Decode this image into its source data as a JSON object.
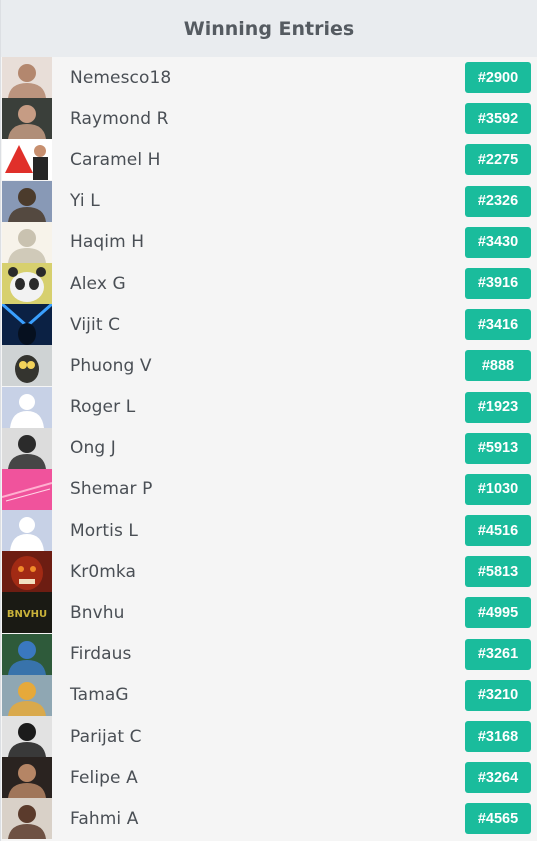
{
  "header": {
    "title": "Winning Entries"
  },
  "entries": [
    {
      "name": "Nemesco18",
      "ticket": "#2900",
      "avatar": "anime-avatar",
      "bg": "#e8ded8",
      "fg": "#b3876e"
    },
    {
      "name": "Raymond R",
      "ticket": "#3592",
      "avatar": "person-photo-avatar",
      "bg": "#3a3f3a",
      "fg": "#c69c84"
    },
    {
      "name": "Caramel H",
      "ticket": "#2275",
      "avatar": "help-sign-avatar",
      "bg": "#ffffff",
      "fg": "#e0302a"
    },
    {
      "name": "Yi L",
      "ticket": "#2326",
      "avatar": "street-photo-avatar",
      "bg": "#8899b6",
      "fg": "#4b3b2c"
    },
    {
      "name": "Haqim H",
      "ticket": "#3430",
      "avatar": "sketch-avatar",
      "bg": "#f7f3ea",
      "fg": "#c9c2b0"
    },
    {
      "name": "Alex G",
      "ticket": "#3916",
      "avatar": "panda-avatar",
      "bg": "#d7d06e",
      "fg": "#2a2a2a"
    },
    {
      "name": "Vijit C",
      "ticket": "#3416",
      "avatar": "blue-light-avatar",
      "bg": "#0b2144",
      "fg": "#3aa0ff"
    },
    {
      "name": "Phuong V",
      "ticket": "#888",
      "avatar": "owl-avatar",
      "bg": "#cfd3d4",
      "fg": "#34342f"
    },
    {
      "name": "Roger L",
      "ticket": "#1923",
      "avatar": "default-silhouette-avatar",
      "bg": "#c7d1e6",
      "fg": "#ffffff"
    },
    {
      "name": "Ong J",
      "ticket": "#5913",
      "avatar": "mirror-selfie-avatar",
      "bg": "#dcdcdc",
      "fg": "#2b2b2b"
    },
    {
      "name": "Shemar P",
      "ticket": "#1030",
      "avatar": "pink-gradient-avatar",
      "bg": "#f25fa2",
      "fg": "#ffb0d0"
    },
    {
      "name": "Mortis L",
      "ticket": "#4516",
      "avatar": "default-silhouette-avatar",
      "bg": "#c7d1e6",
      "fg": "#ffffff"
    },
    {
      "name": "Kr0mka",
      "ticket": "#5813",
      "avatar": "demon-face-avatar",
      "bg": "#6d1d12",
      "fg": "#f08a2a"
    },
    {
      "name": "Bnvhu",
      "ticket": "#4995",
      "avatar": "bnvhu-logo-avatar",
      "bg": "#1a1a14",
      "fg": "#c9b23a",
      "logo_text": "BNVHU"
    },
    {
      "name": "Firdaus",
      "ticket": "#3261",
      "avatar": "outdoor-photo-avatar",
      "bg": "#2e5a3a",
      "fg": "#3a78c0"
    },
    {
      "name": "TamaG",
      "ticket": "#3210",
      "avatar": "figurine-avatar",
      "bg": "#8fa7b3",
      "fg": "#e6a93a"
    },
    {
      "name": "Parijat C",
      "ticket": "#3168",
      "avatar": "bw-portrait-avatar",
      "bg": "#e2e2e2",
      "fg": "#1b1b1b"
    },
    {
      "name": "Felipe A",
      "ticket": "#3264",
      "avatar": "person-photo-avatar",
      "bg": "#2a2320",
      "fg": "#b58565"
    },
    {
      "name": "Fahmi A",
      "ticket": "#4565",
      "avatar": "group-photo-avatar",
      "bg": "#d9d1c8",
      "fg": "#5b3b2c"
    }
  ],
  "colors": {
    "badge": "#1abc9c",
    "header_bg": "#e9ecef",
    "list_bg": "#f5f5f5"
  }
}
